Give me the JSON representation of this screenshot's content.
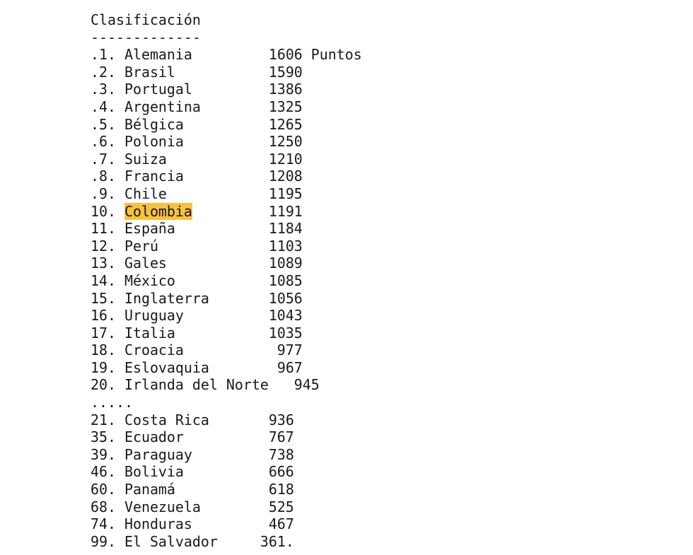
{
  "title": "Clasificación",
  "separator": "-------------",
  "points_label": "Puntos",
  "highlight_color": "#f6c142",
  "ellipsis": ".....",
  "top_rows": [
    {
      "rank": ".1.",
      "country": "Alemania",
      "points": "1606"
    },
    {
      "rank": ".2.",
      "country": "Brasil",
      "points": "1590"
    },
    {
      "rank": ".3.",
      "country": "Portugal",
      "points": "1386"
    },
    {
      "rank": ".4.",
      "country": "Argentina",
      "points": "1325"
    },
    {
      "rank": ".5.",
      "country": "Bélgica",
      "points": "1265"
    },
    {
      "rank": ".6.",
      "country": "Polonia",
      "points": "1250"
    },
    {
      "rank": ".7.",
      "country": "Suiza",
      "points": "1210"
    },
    {
      "rank": ".8.",
      "country": "Francia",
      "points": "1208"
    },
    {
      "rank": ".9.",
      "country": "Chile",
      "points": "1195"
    },
    {
      "rank": "10.",
      "country": "Colombia",
      "points": "1191",
      "highlighted": true
    },
    {
      "rank": "11.",
      "country": "España",
      "points": "1184"
    },
    {
      "rank": "12.",
      "country": "Perú",
      "points": "1103"
    },
    {
      "rank": "13.",
      "country": "Gales",
      "points": "1089"
    },
    {
      "rank": "14.",
      "country": "México",
      "points": "1085"
    },
    {
      "rank": "15.",
      "country": "Inglaterra",
      "points": "1056"
    },
    {
      "rank": "16.",
      "country": "Uruguay",
      "points": "1043"
    },
    {
      "rank": "17.",
      "country": "Italia",
      "points": "1035"
    },
    {
      "rank": "18.",
      "country": "Croacia",
      "points": "977"
    },
    {
      "rank": "19.",
      "country": "Eslovaquia",
      "points": "967"
    },
    {
      "rank": "20.",
      "country": "Irlanda del Norte",
      "points": "945"
    }
  ],
  "other_rows": [
    {
      "rank": "21.",
      "country": "Costa Rica",
      "points": "936"
    },
    {
      "rank": "35.",
      "country": "Ecuador",
      "points": "767"
    },
    {
      "rank": "39.",
      "country": "Paraguay",
      "points": "738"
    },
    {
      "rank": "46.",
      "country": "Bolivia",
      "points": "666"
    },
    {
      "rank": "60.",
      "country": "Panamá",
      "points": "618"
    },
    {
      "rank": "68.",
      "country": "Venezuela",
      "points": "525"
    },
    {
      "rank": "74.",
      "country": "Honduras",
      "points": "467"
    },
    {
      "rank": "99.",
      "country": "El Salvador",
      "points": "361."
    }
  ]
}
